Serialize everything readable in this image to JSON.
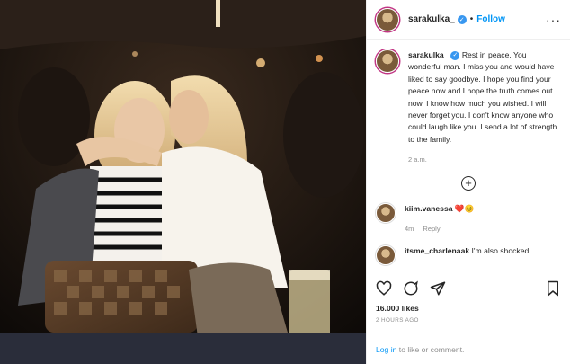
{
  "post": {
    "username": "sarakulka_",
    "follow_label": "Follow",
    "dot": "•",
    "more_icon": "more-horizontal-icon",
    "caption": {
      "username": "sarakulka_",
      "text": "Rest in peace. You wonderful man. I miss you and would have liked to say goodbye. I hope you find your peace now and I hope the truth comes out now. I know how much you wished. I will never forget you. I don't know anyone who could laugh like you. I send a lot of strength to the family.",
      "time": "2 a.m."
    },
    "load_more_icon": "plus-circle-icon",
    "comments": [
      {
        "username": "kiim.vanessa",
        "text": "",
        "emoji": "❤️😊",
        "time": "4m",
        "reply": "Reply"
      },
      {
        "username": "itsme_charlenaak",
        "text": "I'm also shocked"
      }
    ],
    "likes": "16.000 likes",
    "posted_ago": "2 HOURS AGO",
    "login_link": "Log in",
    "login_rest": " to like or comment."
  },
  "colors": {
    "accent": "#0095f6",
    "verified": "#3897f0",
    "muted": "#8e8e8e",
    "heart": "#e0245e"
  }
}
